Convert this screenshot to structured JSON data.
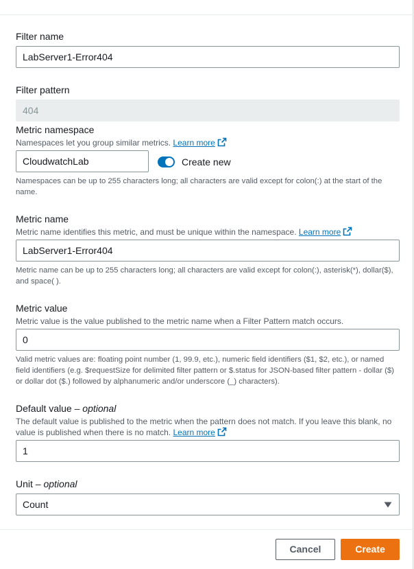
{
  "filter_name": {
    "label": "Filter name",
    "value": "LabServer1-Error404"
  },
  "filter_pattern": {
    "label": "Filter pattern",
    "value": "404"
  },
  "metric_namespace": {
    "label": "Metric namespace",
    "description": "Namespaces let you group similar metrics.",
    "learn_more": "Learn more",
    "value": "CloudwatchLab",
    "toggle_label": "Create new",
    "toggle_on": true,
    "constraint": "Namespaces can be up to 255 characters long; all characters are valid except for colon(:) at the start of the name."
  },
  "metric_name": {
    "label": "Metric name",
    "description": "Metric name identifies this metric, and must be unique within the namespace.",
    "learn_more": "Learn more",
    "value": "LabServer1-Error404",
    "constraint": "Metric name can be up to 255 characters long; all characters are valid except for colon(:), asterisk(*), dollar($), and space( )."
  },
  "metric_value": {
    "label": "Metric value",
    "description": "Metric value is the value published to the metric name when a Filter Pattern match occurs.",
    "value": "0",
    "constraint": "Valid metric values are: floating point number (1, 99.9, etc.), numeric field identifiers ($1, $2, etc.), or named field identifiers (e.g. $requestSize for delimited filter pattern or $.status for JSON-based filter pattern - dollar ($) or dollar dot ($.) followed by alphanumeric and/or underscore (_) characters)."
  },
  "default_value": {
    "label": "Default value",
    "label_optional": "– optional",
    "description": "The default value is published to the metric when the pattern does not match. If you leave this blank, no value is published when there is no match.",
    "learn_more": "Learn more",
    "value": "1"
  },
  "unit": {
    "label": "Unit",
    "label_optional": "– optional",
    "value": "Count"
  },
  "footer": {
    "cancel_label": "Cancel",
    "create_label": "Create"
  },
  "colors": {
    "link": "#0073bb",
    "toggle": "#0073bb",
    "primary_button": "#ec7211"
  }
}
